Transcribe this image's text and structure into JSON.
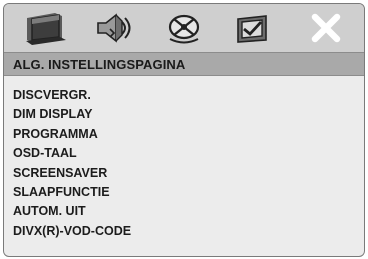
{
  "tabs": [
    {
      "icon": "tv-screen-icon"
    },
    {
      "icon": "speaker-audio-icon"
    },
    {
      "icon": "dolby-disc-icon"
    },
    {
      "icon": "checkbox-preferences-icon"
    },
    {
      "icon": "close-x-icon"
    }
  ],
  "header": {
    "title": "ALG. INSTELLINGSPAGINA"
  },
  "menu": {
    "items": [
      "DISCVERGR.",
      "DIM DISPLAY",
      "PROGRAMMA",
      "OSD-TAAL",
      "SCREENSAVER",
      "SLAAPFUNCTIE",
      "AUTOM. UIT",
      "DIVX(R)-VOD-CODE"
    ]
  },
  "colors": {
    "icon_bar": "#cfcfcf",
    "header_bar": "#a9a9a9",
    "panel_bg": "#ececec",
    "text": "#1c1c1c"
  }
}
